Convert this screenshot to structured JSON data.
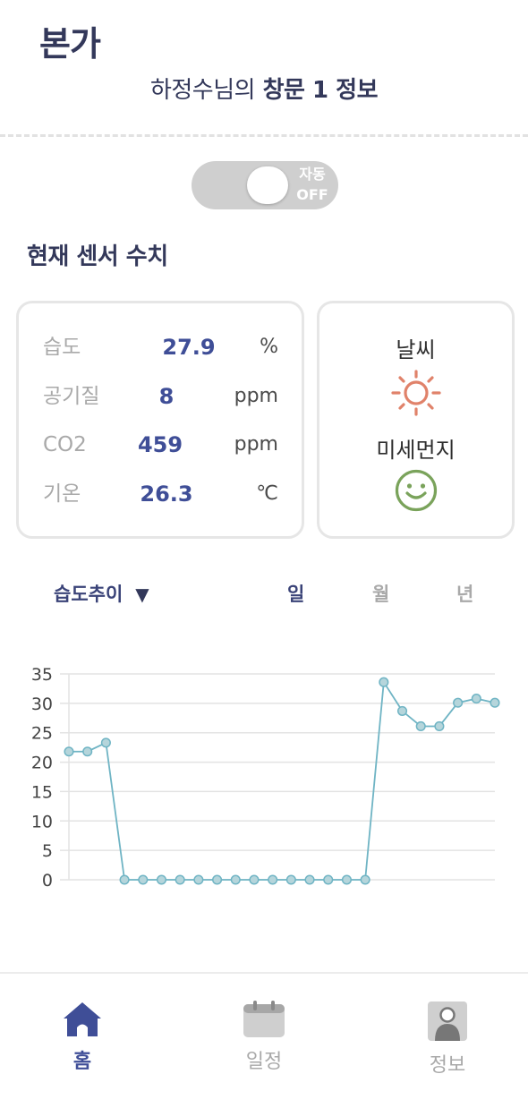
{
  "app": {
    "title": "본가"
  },
  "header": {
    "subtitle_name": "하정수님의",
    "subtitle_rest": "창문 1 정보"
  },
  "auto_toggle": {
    "label_line1": "자동",
    "label_line2": "OFF",
    "state": "off"
  },
  "sensors": {
    "title": "현재 센서 수치",
    "rows": [
      {
        "label": "습도",
        "value": "27.9",
        "unit": "%"
      },
      {
        "label": "공기질",
        "value": "8",
        "unit": "ppm"
      },
      {
        "label": "CO2",
        "value": "459",
        "unit": "ppm"
      },
      {
        "label": "기온",
        "value": "26.3",
        "unit": "℃"
      }
    ]
  },
  "weather": {
    "weather_label": "날씨",
    "weather_icon": "sun-icon",
    "dust_label": "미세먼지",
    "dust_icon": "smiley-icon"
  },
  "chart_controls": {
    "selected_metric": "습도추이",
    "periods": [
      {
        "label": "일",
        "active": true
      },
      {
        "label": "월",
        "active": false
      },
      {
        "label": "년",
        "active": false
      }
    ]
  },
  "chart_data": {
    "type": "line",
    "title": "",
    "xlabel": "",
    "ylabel": "",
    "ylim": [
      0,
      35
    ],
    "yticks": [
      "0",
      "5",
      "10",
      "15",
      "20",
      "25",
      "30",
      "35"
    ],
    "grid": true,
    "series": [
      {
        "values": [
          21.8,
          21.8,
          23.3,
          0,
          0,
          0,
          0,
          0,
          0,
          0,
          0,
          0,
          0,
          0,
          0,
          0,
          0,
          33.6,
          28.7,
          26.1,
          26.1,
          30.1,
          30.8,
          30.1
        ]
      }
    ],
    "colors": {
      "line": "#6fb4c4",
      "point_fill": "#b5d5db",
      "grid": "#e3e3e3",
      "tick_text": "#444444"
    }
  },
  "bottom_nav": {
    "items": [
      {
        "label": "홈",
        "icon": "home-icon",
        "active": true
      },
      {
        "label": "일정",
        "icon": "calendar-icon",
        "active": false
      },
      {
        "label": "정보",
        "icon": "profile-icon",
        "active": false
      }
    ]
  },
  "colors": {
    "accent": "#3f4e97",
    "muted": "#a9a9a9",
    "sun": "#e0826a",
    "smile": "#7aa35b"
  }
}
